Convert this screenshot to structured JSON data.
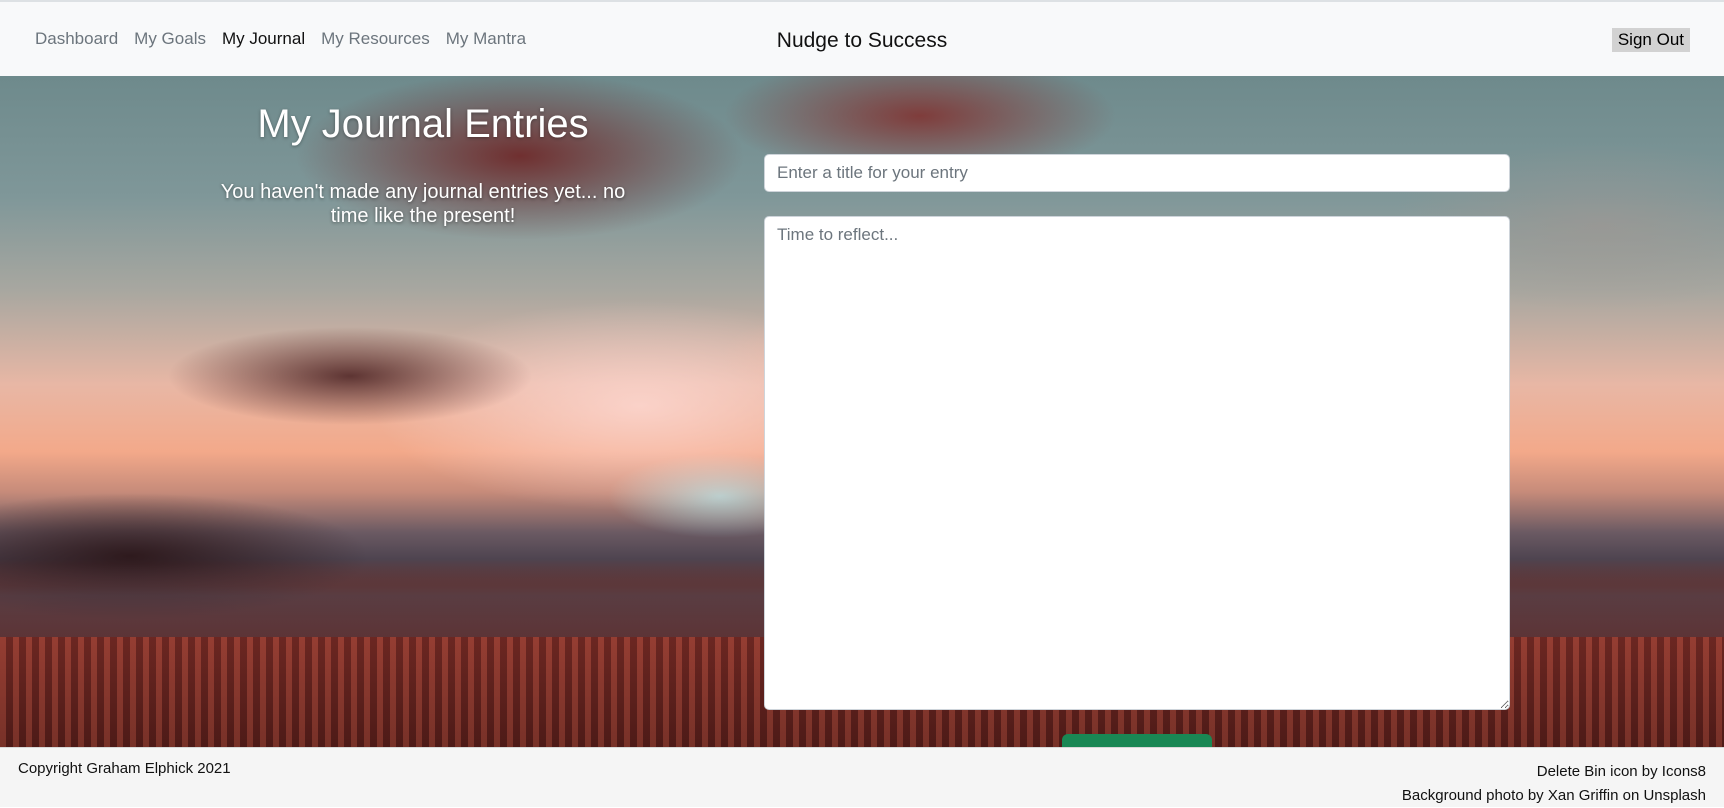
{
  "nav": {
    "links": [
      {
        "label": "Dashboard"
      },
      {
        "label": "My Goals"
      },
      {
        "label": "My Journal"
      },
      {
        "label": "My Resources"
      },
      {
        "label": "My Mantra"
      }
    ],
    "active": "My Journal",
    "brand": "Nudge to Success",
    "signout_label": "Sign Out"
  },
  "main": {
    "title": "My Journal Entries",
    "empty_message": "You haven't made any journal entries yet... no time like the present!",
    "form": {
      "title_placeholder": "Enter a title for your entry",
      "title_value": "",
      "body_placeholder": "Time to reflect...",
      "body_value": ""
    }
  },
  "footer": {
    "copyright": "Copyright Graham Elphick 2021",
    "icon_credit": "Delete Bin icon by Icons8",
    "photo_credit": "Background photo by Xan Griffin on Unsplash"
  },
  "colors": {
    "navbar_bg": "#f8f9fa",
    "nav_inactive": "#6c757d",
    "nav_active": "#111111",
    "signout_bg": "#d2d2d2",
    "submit_green": "#198754",
    "footer_bg": "#f5f5f5"
  }
}
